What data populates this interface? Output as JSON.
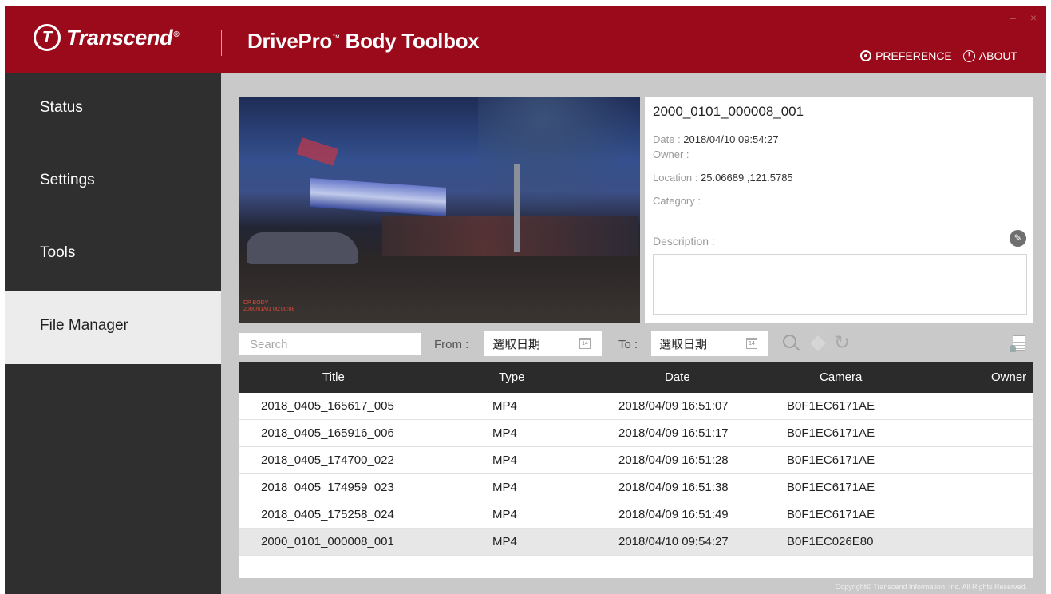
{
  "header": {
    "brand": "Transcend",
    "brand_reg": "®",
    "app_title_main": "DrivePro",
    "app_title_tm": "™",
    "app_title_rest": " Body Toolbox",
    "minimize_glyph": "–",
    "close_glyph": "×",
    "preference_label": "PREFERENCE",
    "about_label": "ABOUT",
    "accent_color": "#9a0a1b"
  },
  "sidebar": {
    "items": [
      {
        "label": "Status"
      },
      {
        "label": "Settings"
      },
      {
        "label": "Tools"
      },
      {
        "label": "File Manager"
      }
    ],
    "active": "File Manager"
  },
  "preview": {
    "stamp_line1": "DP BODY",
    "stamp_line2": "2000/01/01 00:00:08"
  },
  "details": {
    "file_title": "2000_0101_000008_001",
    "date_label": "Date : ",
    "date_value": "2018/04/10 09:54:27",
    "owner_label": "Owner : ",
    "owner_value": "",
    "location_label": "Location : ",
    "location_value": "25.06689 ,121.5785",
    "category_label": "Category : ",
    "category_value": "",
    "description_label": "Description :",
    "description_value": ""
  },
  "filters": {
    "search_placeholder": "Search",
    "from_label": "From :",
    "from_value": "選取日期",
    "to_label": "To :",
    "to_value": "選取日期",
    "calendar_glyph": "14"
  },
  "table": {
    "columns": [
      "Title",
      "Type",
      "Date",
      "Camera",
      "Owner"
    ],
    "rows": [
      {
        "title": "2018_0405_165617_005",
        "type": "MP4",
        "date": "2018/04/09 16:51:07",
        "camera": "B0F1EC6171AE",
        "owner": ""
      },
      {
        "title": "2018_0405_165916_006",
        "type": "MP4",
        "date": "2018/04/09 16:51:17",
        "camera": "B0F1EC6171AE",
        "owner": ""
      },
      {
        "title": "2018_0405_174700_022",
        "type": "MP4",
        "date": "2018/04/09 16:51:28",
        "camera": "B0F1EC6171AE",
        "owner": ""
      },
      {
        "title": "2018_0405_174959_023",
        "type": "MP4",
        "date": "2018/04/09 16:51:38",
        "camera": "B0F1EC6171AE",
        "owner": ""
      },
      {
        "title": "2018_0405_175258_024",
        "type": "MP4",
        "date": "2018/04/09 16:51:49",
        "camera": "B0F1EC6171AE",
        "owner": ""
      },
      {
        "title": "2000_0101_000008_001",
        "type": "MP4",
        "date": "2018/04/10 09:54:27",
        "camera": "B0F1EC026E80",
        "owner": ""
      }
    ],
    "selected_row": 5
  },
  "footer": {
    "copyright": "Copyright© Transcend Information, Inc. All Rights Reserved."
  }
}
